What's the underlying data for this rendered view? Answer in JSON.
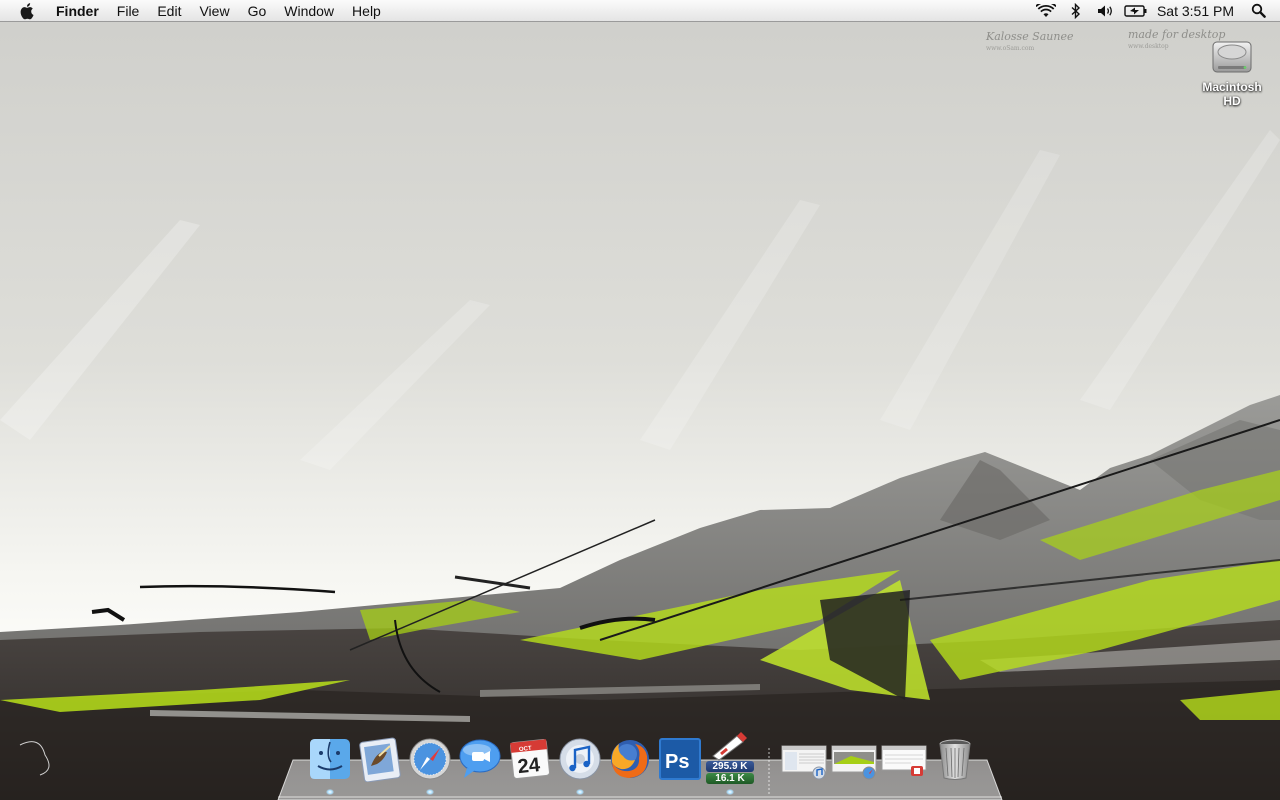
{
  "menubar": {
    "apple_icon": "apple-logo-icon",
    "app_name": "Finder",
    "menus": [
      "File",
      "Edit",
      "View",
      "Go",
      "Window",
      "Help"
    ],
    "status_icons": [
      "wifi-icon",
      "bluetooth-icon",
      "volume-icon",
      "battery-icon"
    ],
    "clock": "Sat 3:51 PM",
    "spotlight_icon": "spotlight-search-icon"
  },
  "desktop": {
    "icons": [
      {
        "label": "Macintosh HD",
        "icon": "hard-drive-icon"
      }
    ],
    "wallpaper_watermarks": [
      {
        "text": "Kalosse Saunee",
        "sub": "www.oSam.com"
      },
      {
        "text": "made for desktop",
        "sub": "www.desktop"
      }
    ]
  },
  "dock": {
    "apps": [
      {
        "name": "Finder",
        "icon": "finder-icon",
        "running": true
      },
      {
        "name": "Mail",
        "icon": "mail-icon",
        "running": false
      },
      {
        "name": "Safari",
        "icon": "safari-icon",
        "running": true
      },
      {
        "name": "iChat",
        "icon": "ichat-icon",
        "running": false
      },
      {
        "name": "iCal",
        "icon": "ical-icon",
        "running": false,
        "month": "OCT",
        "day": "24"
      },
      {
        "name": "iTunes",
        "icon": "itunes-icon",
        "running": true
      },
      {
        "name": "Firefox",
        "icon": "firefox-icon",
        "running": false
      },
      {
        "name": "Photoshop",
        "icon": "photoshop-icon",
        "running": false,
        "label": "Ps"
      },
      {
        "name": "Network Monitor",
        "icon": "network-monitor-icon",
        "running": true,
        "upload": "295.9 K",
        "download": "16.1 K"
      }
    ],
    "docked": [
      {
        "name": "Minimized iTunes window",
        "icon": "minimized-window-itunes-icon"
      },
      {
        "name": "Minimized Safari window",
        "icon": "minimized-window-safari-icon"
      },
      {
        "name": "Minimized document window",
        "icon": "minimized-window-document-icon"
      },
      {
        "name": "Trash",
        "icon": "trash-icon"
      }
    ],
    "accent": "#8ecbff"
  },
  "colors": {
    "sky": "#dcdcd8",
    "mountain": "#8a8a88",
    "ground": "#3a3533",
    "grass_accent": "#b8e01a"
  }
}
